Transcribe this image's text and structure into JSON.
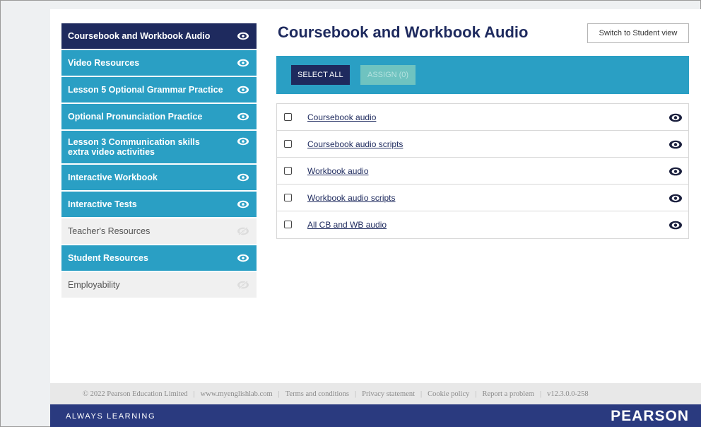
{
  "sidebar": {
    "items": [
      {
        "label": "Coursebook and Workbook Audio",
        "state": "active",
        "icon": "eye-icon"
      },
      {
        "label": "Video Resources",
        "state": "visible",
        "icon": "eye-icon"
      },
      {
        "label": "Lesson 5 Optional Grammar Practice",
        "state": "visible",
        "icon": "eye-icon"
      },
      {
        "label": "Optional Pronunciation Practice",
        "state": "visible",
        "icon": "eye-icon"
      },
      {
        "label": "Lesson 3 Communication skills extra video activities",
        "state": "visible",
        "icon": "eye-icon"
      },
      {
        "label": "Interactive Workbook",
        "state": "visible",
        "icon": "eye-icon"
      },
      {
        "label": "Interactive Tests",
        "state": "visible",
        "icon": "eye-icon"
      },
      {
        "label": "Teacher's Resources",
        "state": "hidden",
        "icon": "eye-slash-icon"
      },
      {
        "label": "Student Resources",
        "state": "visible",
        "icon": "eye-icon"
      },
      {
        "label": "Employability",
        "state": "hidden",
        "icon": "eye-slash-icon"
      }
    ]
  },
  "main": {
    "title": "Coursebook and Workbook Audio",
    "switch_label": "Switch to Student view",
    "toolbar": {
      "select_all_label": "SELECT ALL",
      "assign_label": "ASSIGN (0)"
    },
    "resources": [
      {
        "label": "Coursebook audio",
        "checked": false,
        "icon": "eye-icon"
      },
      {
        "label": "Coursebook audio scripts",
        "checked": false,
        "icon": "eye-icon"
      },
      {
        "label": "Workbook audio",
        "checked": false,
        "icon": "eye-icon"
      },
      {
        "label": "Workbook audio scripts",
        "checked": false,
        "icon": "eye-icon"
      },
      {
        "label": "All CB and WB audio",
        "checked": false,
        "icon": "eye-icon"
      }
    ]
  },
  "footer": {
    "copyright": "© 2022 Pearson Education Limited",
    "links": [
      "www.myenglishlab.com",
      "Terms and conditions",
      "Privacy statement",
      "Cookie policy",
      "Report a problem"
    ],
    "version": "v12.3.0.0-258"
  },
  "bottom_bar": {
    "tagline": "ALWAYS LEARNING",
    "brand": "PEARSON"
  },
  "colors": {
    "navy": "#1e2a5e",
    "teal": "#2a9fc4",
    "assign_disabled": "#6fc3c0",
    "brand_bar": "#2a3a7f"
  }
}
